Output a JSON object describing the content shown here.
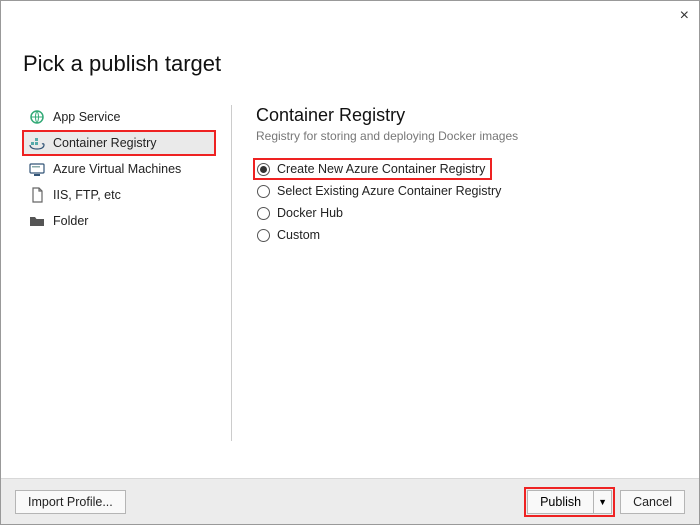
{
  "dialog": {
    "title": "Pick a publish target"
  },
  "sidebar": {
    "items": [
      {
        "label": "App Service"
      },
      {
        "label": "Container Registry"
      },
      {
        "label": "Azure Virtual Machines"
      },
      {
        "label": "IIS, FTP, etc"
      },
      {
        "label": "Folder"
      }
    ],
    "selected_index": 1
  },
  "main": {
    "heading": "Container Registry",
    "subheading": "Registry for storing and deploying Docker images",
    "options": [
      {
        "label": "Create New Azure Container Registry"
      },
      {
        "label": "Select Existing Azure Container Registry"
      },
      {
        "label": "Docker Hub"
      },
      {
        "label": "Custom"
      }
    ],
    "selected_index": 0
  },
  "footer": {
    "import_profile": "Import Profile...",
    "publish": "Publish",
    "dropdown_glyph": "▼",
    "cancel": "Cancel"
  },
  "highlight": {
    "sidebar_index": 1,
    "option_index": 0
  }
}
